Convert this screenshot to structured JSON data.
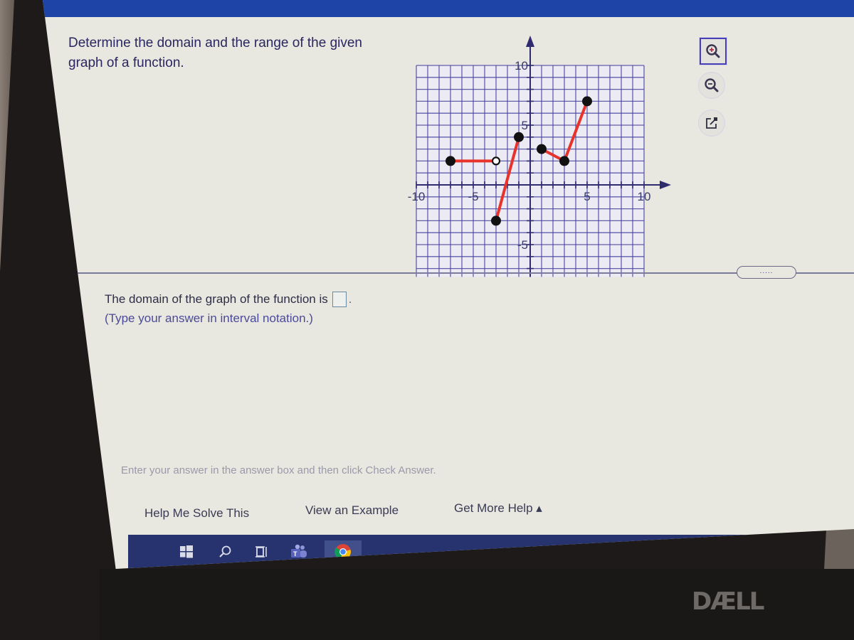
{
  "question": {
    "text": "Determine the domain and the range of the given graph of a function."
  },
  "tools": [
    {
      "name": "zoom-in",
      "label": "Zoom in"
    },
    {
      "name": "zoom-out",
      "label": "Zoom out"
    },
    {
      "name": "pop-out",
      "label": "Open in new window"
    }
  ],
  "more_indicator": ".....",
  "answer": {
    "prompt": "The domain of the graph of the function is",
    "value": "",
    "suffix": ".",
    "hint": "(Type your answer in interval notation.)"
  },
  "instruction": "Enter your answer in the answer box and then click Check Answer.",
  "help_buttons": {
    "help_me_solve": "Help Me Solve This",
    "view_example": "View an Example",
    "get_more_help": "Get More Help ▴"
  },
  "taskbar": {
    "items": [
      "start",
      "search",
      "task-view",
      "teams",
      "chrome"
    ]
  },
  "brand": "DÆLL",
  "colors": {
    "accent": "#1f44a8",
    "curve": "#e8322c",
    "grid": "#4a46a0",
    "text_dark": "#2a2660"
  },
  "chart_data": {
    "type": "line",
    "title": "",
    "xlabel": "",
    "ylabel": "",
    "xlim": [
      -10,
      10
    ],
    "ylim": [
      -10,
      10
    ],
    "grid": true,
    "x_tick_labels": [
      "-10",
      "-5",
      "5",
      "10"
    ],
    "y_tick_labels": [
      "10",
      "5",
      "-5"
    ],
    "x_ticks": [
      -10,
      -5,
      5,
      10
    ],
    "y_ticks": [
      10,
      5,
      -5
    ],
    "series": [
      {
        "name": "piece-1",
        "points": [
          [
            -7,
            2
          ],
          [
            -3,
            2
          ]
        ],
        "endpoints": [
          "closed",
          "open"
        ]
      },
      {
        "name": "piece-2",
        "points": [
          [
            -3,
            -3
          ],
          [
            -1,
            4
          ]
        ],
        "endpoints": [
          "closed",
          "closed"
        ]
      },
      {
        "name": "piece-3",
        "points": [
          [
            1,
            3
          ],
          [
            3,
            2
          ],
          [
            5,
            7
          ]
        ],
        "endpoints": [
          "closed",
          "closed",
          "closed"
        ]
      }
    ]
  }
}
